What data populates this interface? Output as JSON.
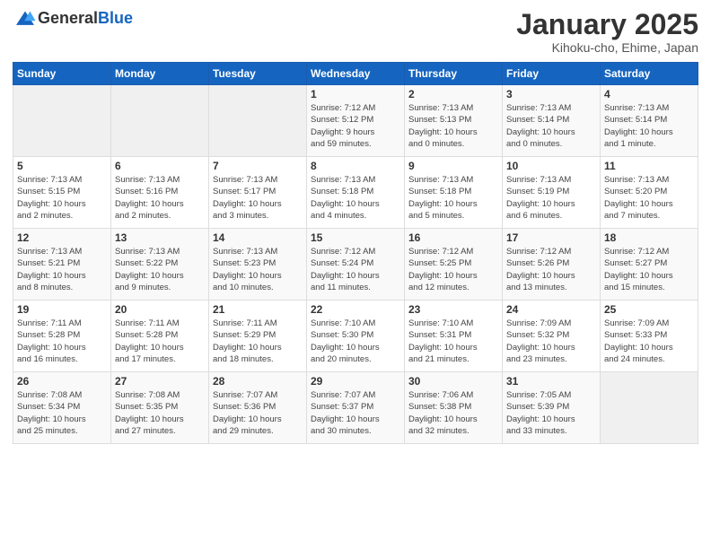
{
  "header": {
    "logo_general": "General",
    "logo_blue": "Blue",
    "month_title": "January 2025",
    "location": "Kihoku-cho, Ehime, Japan"
  },
  "weekdays": [
    "Sunday",
    "Monday",
    "Tuesday",
    "Wednesday",
    "Thursday",
    "Friday",
    "Saturday"
  ],
  "weeks": [
    [
      {
        "day": "",
        "info": ""
      },
      {
        "day": "",
        "info": ""
      },
      {
        "day": "",
        "info": ""
      },
      {
        "day": "1",
        "info": "Sunrise: 7:12 AM\nSunset: 5:12 PM\nDaylight: 9 hours\nand 59 minutes."
      },
      {
        "day": "2",
        "info": "Sunrise: 7:13 AM\nSunset: 5:13 PM\nDaylight: 10 hours\nand 0 minutes."
      },
      {
        "day": "3",
        "info": "Sunrise: 7:13 AM\nSunset: 5:14 PM\nDaylight: 10 hours\nand 0 minutes."
      },
      {
        "day": "4",
        "info": "Sunrise: 7:13 AM\nSunset: 5:14 PM\nDaylight: 10 hours\nand 1 minute."
      }
    ],
    [
      {
        "day": "5",
        "info": "Sunrise: 7:13 AM\nSunset: 5:15 PM\nDaylight: 10 hours\nand 2 minutes."
      },
      {
        "day": "6",
        "info": "Sunrise: 7:13 AM\nSunset: 5:16 PM\nDaylight: 10 hours\nand 2 minutes."
      },
      {
        "day": "7",
        "info": "Sunrise: 7:13 AM\nSunset: 5:17 PM\nDaylight: 10 hours\nand 3 minutes."
      },
      {
        "day": "8",
        "info": "Sunrise: 7:13 AM\nSunset: 5:18 PM\nDaylight: 10 hours\nand 4 minutes."
      },
      {
        "day": "9",
        "info": "Sunrise: 7:13 AM\nSunset: 5:18 PM\nDaylight: 10 hours\nand 5 minutes."
      },
      {
        "day": "10",
        "info": "Sunrise: 7:13 AM\nSunset: 5:19 PM\nDaylight: 10 hours\nand 6 minutes."
      },
      {
        "day": "11",
        "info": "Sunrise: 7:13 AM\nSunset: 5:20 PM\nDaylight: 10 hours\nand 7 minutes."
      }
    ],
    [
      {
        "day": "12",
        "info": "Sunrise: 7:13 AM\nSunset: 5:21 PM\nDaylight: 10 hours\nand 8 minutes."
      },
      {
        "day": "13",
        "info": "Sunrise: 7:13 AM\nSunset: 5:22 PM\nDaylight: 10 hours\nand 9 minutes."
      },
      {
        "day": "14",
        "info": "Sunrise: 7:13 AM\nSunset: 5:23 PM\nDaylight: 10 hours\nand 10 minutes."
      },
      {
        "day": "15",
        "info": "Sunrise: 7:12 AM\nSunset: 5:24 PM\nDaylight: 10 hours\nand 11 minutes."
      },
      {
        "day": "16",
        "info": "Sunrise: 7:12 AM\nSunset: 5:25 PM\nDaylight: 10 hours\nand 12 minutes."
      },
      {
        "day": "17",
        "info": "Sunrise: 7:12 AM\nSunset: 5:26 PM\nDaylight: 10 hours\nand 13 minutes."
      },
      {
        "day": "18",
        "info": "Sunrise: 7:12 AM\nSunset: 5:27 PM\nDaylight: 10 hours\nand 15 minutes."
      }
    ],
    [
      {
        "day": "19",
        "info": "Sunrise: 7:11 AM\nSunset: 5:28 PM\nDaylight: 10 hours\nand 16 minutes."
      },
      {
        "day": "20",
        "info": "Sunrise: 7:11 AM\nSunset: 5:28 PM\nDaylight: 10 hours\nand 17 minutes."
      },
      {
        "day": "21",
        "info": "Sunrise: 7:11 AM\nSunset: 5:29 PM\nDaylight: 10 hours\nand 18 minutes."
      },
      {
        "day": "22",
        "info": "Sunrise: 7:10 AM\nSunset: 5:30 PM\nDaylight: 10 hours\nand 20 minutes."
      },
      {
        "day": "23",
        "info": "Sunrise: 7:10 AM\nSunset: 5:31 PM\nDaylight: 10 hours\nand 21 minutes."
      },
      {
        "day": "24",
        "info": "Sunrise: 7:09 AM\nSunset: 5:32 PM\nDaylight: 10 hours\nand 23 minutes."
      },
      {
        "day": "25",
        "info": "Sunrise: 7:09 AM\nSunset: 5:33 PM\nDaylight: 10 hours\nand 24 minutes."
      }
    ],
    [
      {
        "day": "26",
        "info": "Sunrise: 7:08 AM\nSunset: 5:34 PM\nDaylight: 10 hours\nand 25 minutes."
      },
      {
        "day": "27",
        "info": "Sunrise: 7:08 AM\nSunset: 5:35 PM\nDaylight: 10 hours\nand 27 minutes."
      },
      {
        "day": "28",
        "info": "Sunrise: 7:07 AM\nSunset: 5:36 PM\nDaylight: 10 hours\nand 29 minutes."
      },
      {
        "day": "29",
        "info": "Sunrise: 7:07 AM\nSunset: 5:37 PM\nDaylight: 10 hours\nand 30 minutes."
      },
      {
        "day": "30",
        "info": "Sunrise: 7:06 AM\nSunset: 5:38 PM\nDaylight: 10 hours\nand 32 minutes."
      },
      {
        "day": "31",
        "info": "Sunrise: 7:05 AM\nSunset: 5:39 PM\nDaylight: 10 hours\nand 33 minutes."
      },
      {
        "day": "",
        "info": ""
      }
    ]
  ]
}
